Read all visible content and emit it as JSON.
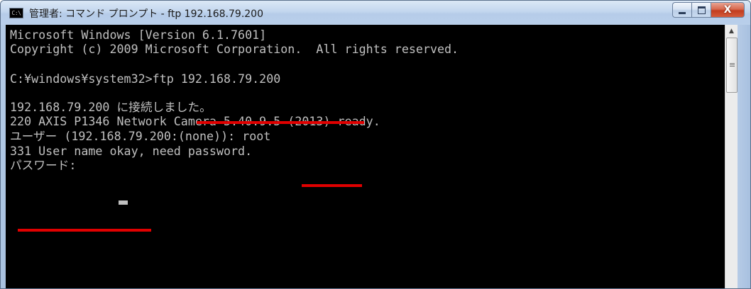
{
  "window": {
    "title": "管理者: コマンド プロンプト - ftp  192.168.79.200",
    "icon_label": "C:\\",
    "icon_name": "cmd-icon"
  },
  "controls": {
    "minimize_icon": "minimize-icon",
    "maximize_icon": "maximize-icon",
    "close_label": "X"
  },
  "console": {
    "lines": [
      "Microsoft Windows [Version 6.1.7601]",
      "Copyright (c) 2009 Microsoft Corporation.  All rights reserved.",
      "C:¥windows¥system32>ftp 192.168.79.200",
      "192.168.79.200 に接続しました。",
      "220 AXIS P1346 Network Camera 5.40.9.5 (2013) ready.",
      "ユーザー (192.168.79.200:(none)): root",
      "331 User name okay, need password.",
      "パスワード: "
    ]
  },
  "annotations": {
    "color": "#e00000"
  },
  "scrollbar": {
    "up_arrow": "▲"
  }
}
